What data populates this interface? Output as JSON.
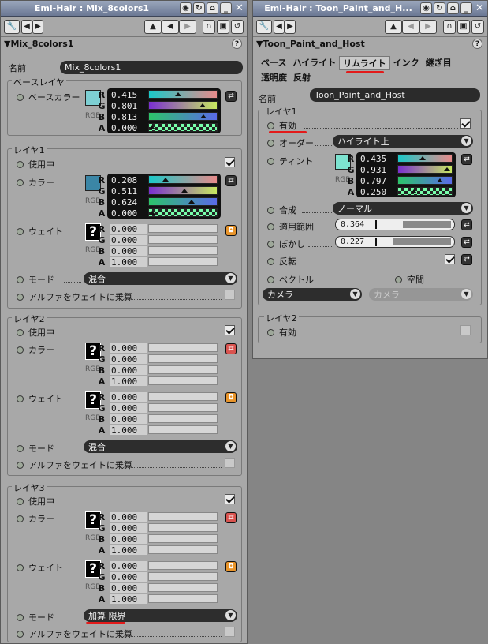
{
  "left": {
    "window_title": "Emi-Hair : Mix_8colors1",
    "header": "Mix_8colors1",
    "name_label": "名前",
    "name_value": "Mix_8colors1",
    "base_group": "ベースレイヤ",
    "base_color_label": "ベースカラー",
    "base_color": "#7dcfd3",
    "base_rgba": [
      "0.415",
      "0.801",
      "0.813",
      "0.000"
    ],
    "layer1": {
      "title": "レイヤ1",
      "enabled_label": "使用中",
      "color_label": "カラー",
      "color": "#3b86a6",
      "rgba": [
        "0.208",
        "0.511",
        "0.624",
        "0.000"
      ],
      "weight_label": "ウェイト",
      "weight": [
        "0.000",
        "0.000",
        "0.000",
        "1.000"
      ],
      "mode_label": "モード",
      "mode": "混合",
      "alpha_label": "アルファをウェイトに乗算"
    },
    "layer2": {
      "title": "レイヤ2",
      "enabled_label": "使用中",
      "color_label": "カラー",
      "color": [
        "0.000",
        "0.000",
        "0.000",
        "1.000"
      ],
      "weight_label": "ウェイト",
      "weight": [
        "0.000",
        "0.000",
        "0.000",
        "1.000"
      ],
      "mode_label": "モード",
      "mode": "混合",
      "alpha_label": "アルファをウェイトに乗算"
    },
    "layer3": {
      "title": "レイヤ3",
      "enabled_label": "使用中",
      "color_label": "カラー",
      "color": [
        "0.000",
        "0.000",
        "0.000",
        "1.000"
      ],
      "weight_label": "ウェイト",
      "weight": [
        "0.000",
        "0.000",
        "0.000",
        "1.000"
      ],
      "mode_label": "モード",
      "mode": "加算 限界",
      "alpha_label": "アルファをウェイトに乗算"
    },
    "rgb_tag": "RGB",
    "qmark": "?"
  },
  "right": {
    "window_title": "Emi-Hair : Toon_Paint_and_H...",
    "header": "Toon_Paint_and_Host",
    "tabs_row1": [
      "ベース",
      "ハイライト",
      "リムライト",
      "インク",
      "継ぎ目"
    ],
    "tabs_row2": [
      "透明度",
      "反射"
    ],
    "active_tab": "リムライト",
    "name_label": "名前",
    "name_value": "Toon_Paint_and_Host",
    "layer1_title": "レイヤ1",
    "enabled_label": "有効",
    "order_label": "オーダー",
    "order_value": "ハイライト上",
    "tint_label": "ティント",
    "tint_color": "#7de3d0",
    "tint_rgba": [
      "0.435",
      "0.931",
      "0.797",
      "0.250"
    ],
    "blend_label": "合成",
    "blend_value": "ノーマル",
    "range_label": "適用範囲",
    "range_value": "0.364",
    "blur_label": "ぼかし",
    "blur_value": "0.227",
    "invert_label": "反転",
    "vector_label": "ベクトル",
    "space_label": "空間",
    "camera_value": "カメラ",
    "camera_value2": "カメラ",
    "layer2_title": "レイヤ2",
    "layer2_enabled_label": "有効",
    "rgb_tag": "RGB"
  },
  "channels": [
    "R",
    "G",
    "B",
    "A"
  ],
  "toolbar": {
    "back": "◀",
    "fwd": "▶",
    "up": "▲"
  }
}
